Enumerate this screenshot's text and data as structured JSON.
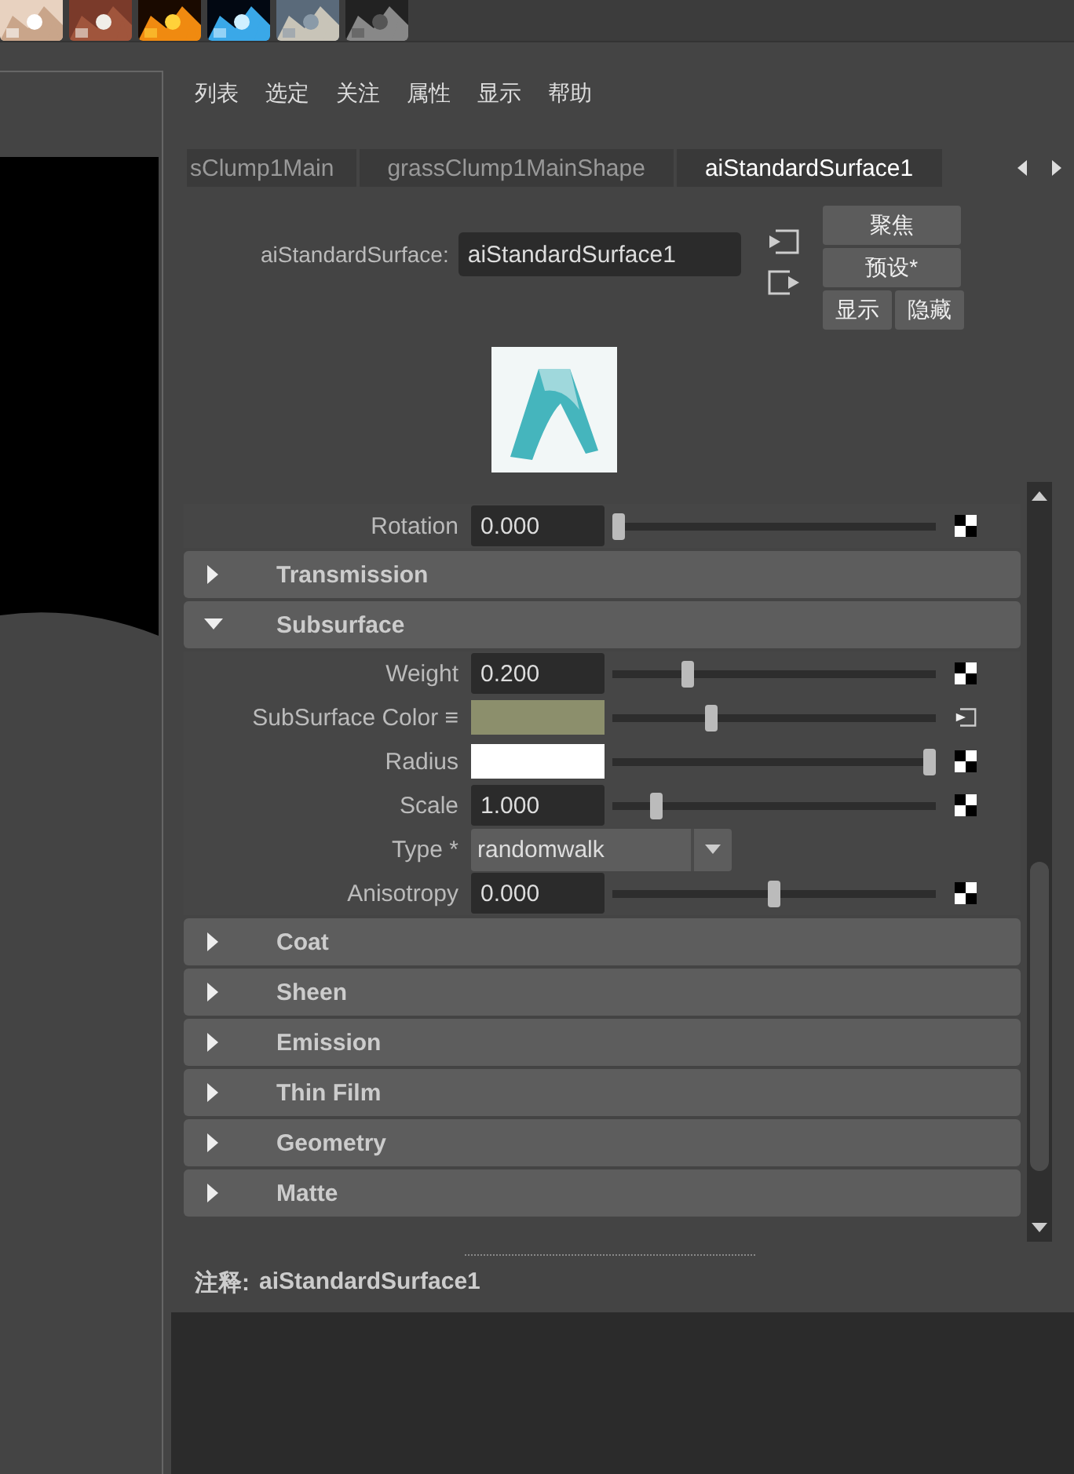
{
  "menu": [
    "列表",
    "选定",
    "关注",
    "属性",
    "显示",
    "帮助"
  ],
  "tabs": [
    {
      "label": "sClump1Main",
      "selected": false
    },
    {
      "label": "grassClump1MainShape",
      "selected": false
    },
    {
      "label": "aiStandardSurface1",
      "selected": true
    }
  ],
  "node": {
    "label": "aiStandardSurface:",
    "value": "aiStandardSurface1"
  },
  "buttons": {
    "focus": "聚焦",
    "presets": "预设*",
    "show": "显示",
    "hide": "隐藏"
  },
  "top_rows": [
    {
      "kind": "slider",
      "label": "Rotation",
      "value": "0.000",
      "level": 0
    }
  ],
  "sections": [
    {
      "title": "Transmission",
      "expanded": false
    },
    {
      "title": "Subsurface",
      "expanded": true,
      "rows": [
        {
          "kind": "slider",
          "label": "Weight",
          "value": "0.200",
          "level": 0.22
        },
        {
          "kind": "color",
          "label": "SubSurface Color ≡",
          "color": "#8c8f6c",
          "level": 0.3
        },
        {
          "kind": "color-map",
          "label": "Radius",
          "color": "#ffffff",
          "level": 1
        },
        {
          "kind": "slider",
          "label": "Scale",
          "value": "1.000",
          "level": 0.12
        },
        {
          "kind": "dropdown",
          "label": "Type *",
          "value": "randomwalk"
        },
        {
          "kind": "slider",
          "label": "Anisotropy",
          "value": "0.000",
          "level": 0.5
        }
      ]
    },
    {
      "title": "Coat",
      "expanded": false
    },
    {
      "title": "Sheen",
      "expanded": false
    },
    {
      "title": "Emission",
      "expanded": false
    },
    {
      "title": "Thin Film",
      "expanded": false
    },
    {
      "title": "Geometry",
      "expanded": false
    },
    {
      "title": "Matte",
      "expanded": false
    }
  ],
  "notes": {
    "label": "注释:",
    "value": "aiStandardSurface1"
  }
}
